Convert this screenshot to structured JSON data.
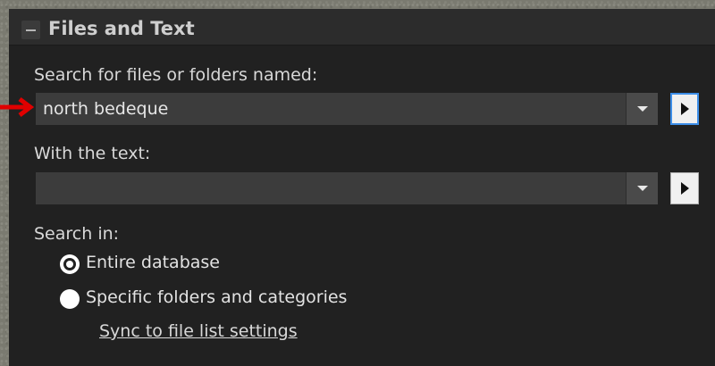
{
  "panel": {
    "title": "Files and Text"
  },
  "name_search": {
    "label": "Search for files or folders named:",
    "value": "north bedeque"
  },
  "text_search": {
    "label": "With the text:",
    "value": ""
  },
  "search_in": {
    "label": "Search in:",
    "options": [
      {
        "label": "Entire database",
        "selected": true
      },
      {
        "label": "Specific folders and categories",
        "selected": false
      }
    ],
    "sync_link": "Sync to file list settings"
  },
  "icons": {
    "collapse": "minus-icon",
    "dropdown": "chevron-down-icon",
    "go": "play-arrow-icon",
    "annotation": "red-arrow-icon"
  },
  "colors": {
    "panel_bg": "#212121",
    "focus_border": "#3d8ee8",
    "annotation_arrow": "#e00000"
  }
}
